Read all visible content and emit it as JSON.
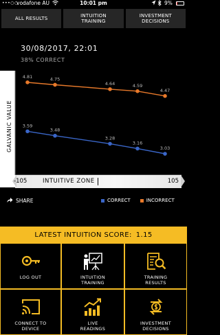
{
  "status_bar": {
    "signal": "•••○○",
    "carrier": "vodafone AU",
    "time": "10:01 pm",
    "battery": "9%",
    "battery_level": 0.09
  },
  "tabs": [
    {
      "lines": [
        "ALL RESULTS"
      ]
    },
    {
      "lines": [
        "INTUITION",
        "TRAINING"
      ]
    },
    {
      "lines": [
        "INVESTMENT",
        "DECISIONS"
      ]
    }
  ],
  "header": {
    "datetime": "30/08/2017, 22:01",
    "correct": "38% CORRECT"
  },
  "chart_data": {
    "type": "line",
    "ylabel": "GALVANIC VALUE",
    "ylim": [
      2.5,
      5.1
    ],
    "x": [
      1,
      2,
      3,
      4,
      5,
      6
    ],
    "series": [
      {
        "name": "CORRECT",
        "color": "#3a66c8",
        "values": [
          3.59,
          3.48,
          null,
          3.28,
          3.16,
          3.03
        ]
      },
      {
        "name": "INCORRECT",
        "color": "#e8792a",
        "values": [
          4.81,
          4.75,
          null,
          4.64,
          4.59,
          4.47
        ]
      }
    ]
  },
  "zone": {
    "left": "-105",
    "label": "INTUITIVE ZONE",
    "right": "105"
  },
  "share_label": "SHARE",
  "legend": {
    "correct": "CORRECT",
    "incorrect": "INCORRECT",
    "correct_color": "#3a66c8",
    "incorrect_color": "#e8792a"
  },
  "score": {
    "label": "LATEST INTUITION SCORE:",
    "value": "1.15"
  },
  "tiles": [
    {
      "icon": "log-out-key-icon",
      "lines": [
        "LOG OUT"
      ]
    },
    {
      "icon": "presentation-icon",
      "lines": [
        "INTUITION",
        "TRAINING"
      ]
    },
    {
      "icon": "results-search-icon",
      "lines": [
        "TRAINING",
        "RESULTS"
      ]
    },
    {
      "icon": "cast-device-icon",
      "lines": [
        "CONNECT TO",
        "DEVICE"
      ]
    },
    {
      "icon": "live-readings-icon",
      "lines": [
        "LIVE",
        "READINGS"
      ]
    },
    {
      "icon": "investment-icon",
      "lines": [
        "INVESTMENT",
        "DECISIONS"
      ]
    }
  ]
}
